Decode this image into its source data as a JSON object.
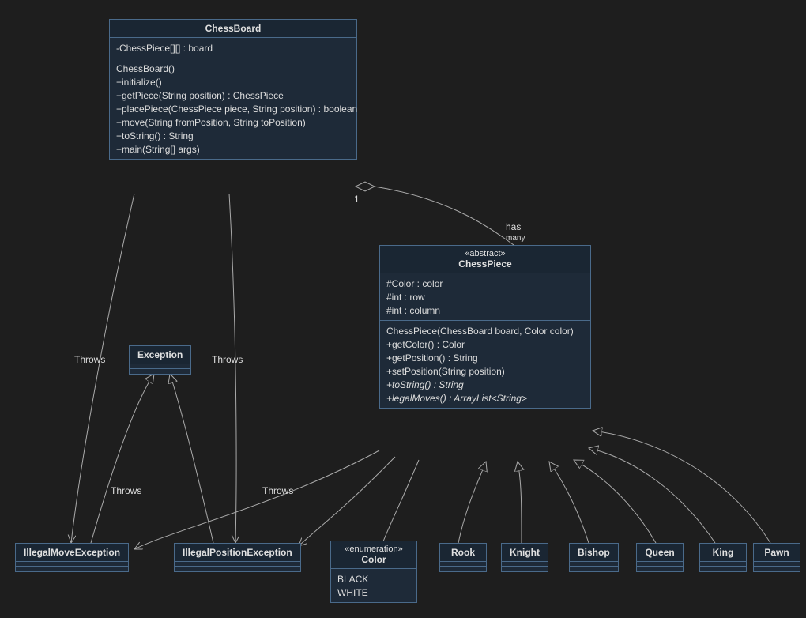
{
  "chessBoard": {
    "name": "ChessBoard",
    "fields": [
      "-ChessPiece[][] : board"
    ],
    "methods": [
      "ChessBoard()",
      "+initialize()",
      "+getPiece(String position) : ChessPiece",
      "+placePiece(ChessPiece piece, String position) : boolean",
      "+move(String fromPosition, String toPosition)",
      "+toString() : String",
      "+main(String[] args)"
    ]
  },
  "chessPiece": {
    "stereotype": "«abstract»",
    "name": "ChessPiece",
    "fields": [
      "#Color : color",
      "#int : row",
      "#int : column"
    ],
    "methods": [
      "ChessPiece(ChessBoard board, Color color)",
      "+getColor() : Color",
      "+getPosition() : String",
      "+setPosition(String position)",
      "+toString() : String",
      "+legalMoves() : ArrayList<String>"
    ],
    "abstractMethods": [
      "+toString() : String",
      "+legalMoves() : ArrayList<String>"
    ]
  },
  "color": {
    "stereotype": "«enumeration»",
    "name": "Color",
    "values": [
      "BLACK",
      "WHITE"
    ]
  },
  "exception": {
    "name": "Exception"
  },
  "illegalMove": {
    "name": "IllegalMoveException"
  },
  "illegalPos": {
    "name": "IllegalPositionException"
  },
  "rook": {
    "name": "Rook"
  },
  "knight": {
    "name": "Knight"
  },
  "bishop": {
    "name": "Bishop"
  },
  "queen": {
    "name": "Queen"
  },
  "king": {
    "name": "King"
  },
  "pawn": {
    "name": "Pawn"
  },
  "relLabels": {
    "has": "has",
    "one": "1",
    "many": "many",
    "throws1": "Throws",
    "throws2": "Throws",
    "throws3": "Throws",
    "throws4": "Throws"
  }
}
